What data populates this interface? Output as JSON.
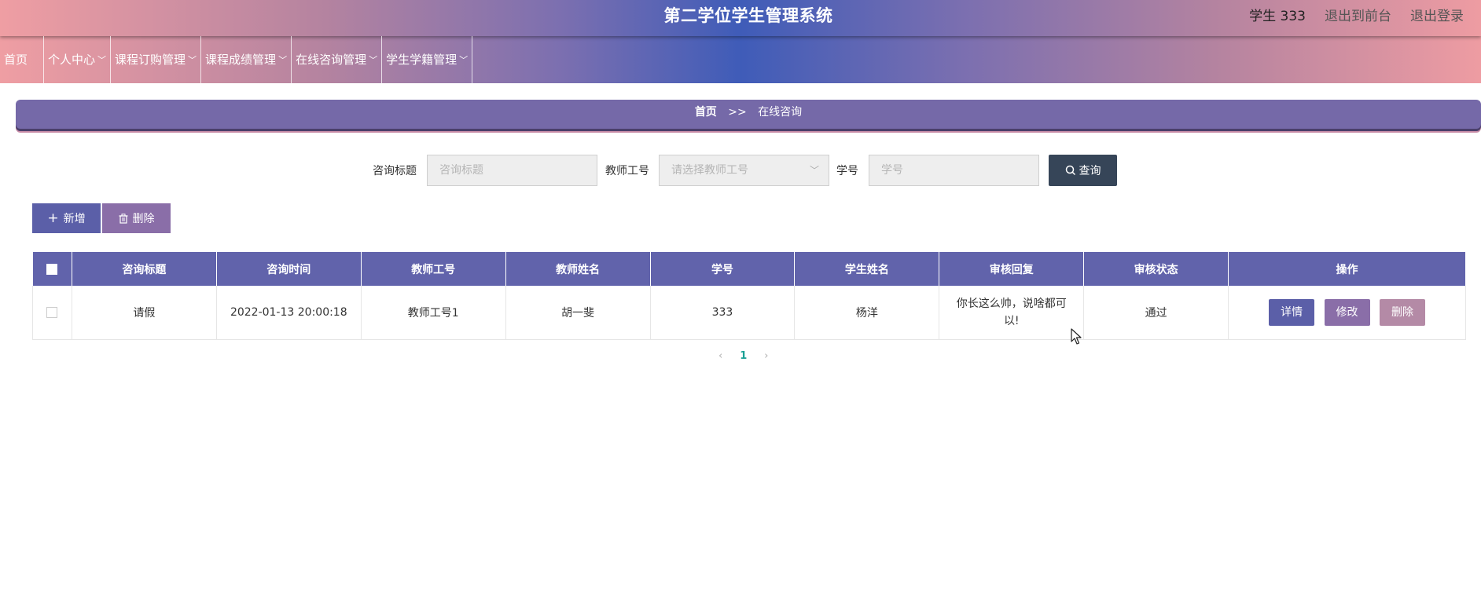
{
  "app": {
    "title": "第二学位学生管理系统",
    "user": "学生 333",
    "link_front": "退出到前台",
    "link_logout": "退出登录"
  },
  "nav": {
    "home": "首页",
    "items": [
      "个人中心",
      "课程订购管理",
      "课程成绩管理",
      "在线咨询管理",
      "学生学籍管理"
    ]
  },
  "breadcrumb": {
    "home": "首页",
    "sep": ">>",
    "current": "在线咨询"
  },
  "search": {
    "title_label": "咨询标题",
    "title_placeholder": "咨询标题",
    "teacher_label": "教师工号",
    "teacher_placeholder": "请选择教师工号",
    "student_label": "学号",
    "student_placeholder": "学号",
    "button": "查询"
  },
  "actions": {
    "add": "新增",
    "delete": "删除"
  },
  "table": {
    "headers": [
      "咨询标题",
      "咨询时间",
      "教师工号",
      "教师姓名",
      "学号",
      "学生姓名",
      "审核回复",
      "审核状态",
      "操作"
    ],
    "rows": [
      {
        "title": "请假",
        "time": "2022-01-13 20:00:18",
        "teacher_id": "教师工号1",
        "teacher_name": "胡一斐",
        "student_id": "333",
        "student_name": "杨洋",
        "reply": "你长这么帅，说啥都可以!",
        "status": "通过",
        "op_detail": "详情",
        "op_edit": "修改",
        "op_delete": "删除"
      }
    ]
  },
  "pager": {
    "prev": "‹",
    "page": "1",
    "next": "›"
  }
}
